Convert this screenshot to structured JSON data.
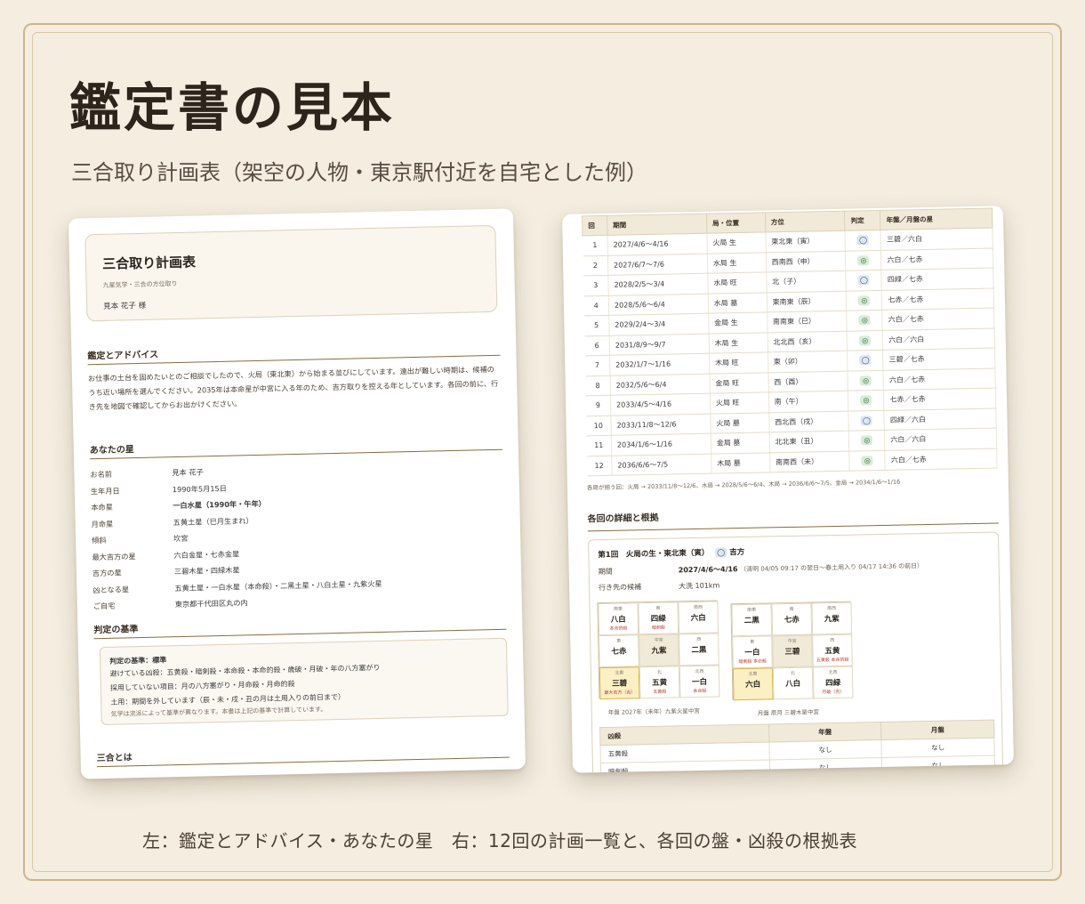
{
  "title": "鑑定書の見本",
  "subtitle": "三合取り計画表（架空の人物・東京駅付近を自宅とした例）",
  "caption": "左：鑑定とアドバイス・あなたの星　右：12回の計画一覧と、各回の盤・凶殺の根拠表",
  "left_page": {
    "header": {
      "title": "三合取り計画表",
      "subtitle": "九星気学・三合の方位取り",
      "name": "見本 花子 様"
    },
    "advice": {
      "heading": "鑑定とアドバイス",
      "text": "お仕事の土台を固めたいとのご相談でしたので、火局（東北東）から始まる並びにしています。遠出が難しい時期は、候補のうち近い場所を選んでください。2035年は本命星が中宮に入る年のため、吉方取りを控える年としています。各回の前に、行き先を地図で確認してからお出かけください。"
    },
    "stars": {
      "heading": "あなたの星",
      "rows": [
        {
          "k": "お名前",
          "v": "見本 花子",
          "bold": false
        },
        {
          "k": "生年月日",
          "v": "1990年5月15日",
          "bold": false
        },
        {
          "k": "本命星",
          "v": "一白水星（1990年・午年）",
          "bold": true
        },
        {
          "k": "月命星",
          "v": "五黄土星（巳月生まれ）",
          "bold": false
        },
        {
          "k": "傾斜",
          "v": "坎宮",
          "bold": false
        },
        {
          "k": "最大吉方の星",
          "v": "六白金星・七赤金星",
          "bold": false
        },
        {
          "k": "吉方の星",
          "v": "三碧木星・四緑木星",
          "bold": false
        },
        {
          "k": "凶となる星",
          "v": "五黄土星・一白水星（本命殺）・二黒土星・八白土星・九紫火星",
          "bold": false
        },
        {
          "k": "ご自宅",
          "v": "東京都千代田区丸の内",
          "bold": false
        }
      ]
    },
    "criteria": {
      "heading": "判定の基準",
      "lines": [
        {
          "text": "判定の基準：標準",
          "style": "t"
        },
        {
          "text": "避けている凶殺：五黄殺・暗剣殺・本命殺・本命的殺・歳破・月破・年の八方塞がり",
          "style": ""
        },
        {
          "text": "採用していない項目：月の八方塞がり・月命殺・月命的殺",
          "style": ""
        },
        {
          "text": "土用：期間を外しています（辰・未・戌・丑の月は土用入りの前日まで）",
          "style": ""
        },
        {
          "text": "気学は流派によって基準が異なります。本書は上記の基準で計算しています。",
          "style": "s"
        }
      ]
    },
    "sango": {
      "heading": "三合とは"
    }
  },
  "right_page": {
    "table_headers": [
      "回",
      "期間",
      "局・位置",
      "方位",
      "判定",
      "年盤／月盤の星"
    ],
    "rows": [
      {
        "n": "1",
        "period": "2027/4/6〜4/16",
        "kyoku": "火局 生",
        "dir": "東北東（寅）",
        "mark": "◯",
        "mk": "o",
        "stars": "三碧／六白"
      },
      {
        "n": "2",
        "period": "2027/6/7〜7/6",
        "kyoku": "水局 生",
        "dir": "西南西（申）",
        "mark": "◎",
        "mk": "d",
        "stars": "六白／七赤"
      },
      {
        "n": "3",
        "period": "2028/2/5〜3/4",
        "kyoku": "水局 旺",
        "dir": "北（子）",
        "mark": "◯",
        "mk": "o",
        "stars": "四緑／七赤"
      },
      {
        "n": "4",
        "period": "2028/5/6〜6/4",
        "kyoku": "水局 墓",
        "dir": "東南東（辰）",
        "mark": "◎",
        "mk": "d",
        "stars": "七赤／七赤"
      },
      {
        "n": "5",
        "period": "2029/2/4〜3/4",
        "kyoku": "金局 生",
        "dir": "南南東（巳）",
        "mark": "◎",
        "mk": "d",
        "stars": "六白／七赤"
      },
      {
        "n": "6",
        "period": "2031/8/9〜9/7",
        "kyoku": "木局 生",
        "dir": "北北西（亥）",
        "mark": "◎",
        "mk": "d",
        "stars": "六白／六白"
      },
      {
        "n": "7",
        "period": "2032/1/7〜1/16",
        "kyoku": "木局 旺",
        "dir": "東（卯）",
        "mark": "◯",
        "mk": "o",
        "stars": "三碧／七赤"
      },
      {
        "n": "8",
        "period": "2032/5/6〜6/4",
        "kyoku": "金局 旺",
        "dir": "西（酉）",
        "mark": "◎",
        "mk": "d",
        "stars": "六白／七赤"
      },
      {
        "n": "9",
        "period": "2033/4/5〜4/16",
        "kyoku": "火局 旺",
        "dir": "南（午）",
        "mark": "◎",
        "mk": "d",
        "stars": "七赤／七赤"
      },
      {
        "n": "10",
        "period": "2033/11/8〜12/6",
        "kyoku": "火局 墓",
        "dir": "西北西（戌）",
        "mark": "◯",
        "mk": "o",
        "stars": "四緑／六白"
      },
      {
        "n": "11",
        "period": "2034/1/6〜1/16",
        "kyoku": "金局 墓",
        "dir": "北北東（丑）",
        "mark": "◎",
        "mk": "d",
        "stars": "六白／六白"
      },
      {
        "n": "12",
        "period": "2036/6/6〜7/5",
        "kyoku": "木局 墓",
        "dir": "南南西（未）",
        "mark": "◎",
        "mk": "d",
        "stars": "六白／七赤"
      }
    ],
    "note": "各局が揃う回：火局 → 2033/11/8〜12/6、水局 → 2028/5/6〜6/4、木局 → 2036/6/6〜7/5、金局 → 2034/1/6〜1/16",
    "detail_heading": "各回の詳細と根拠",
    "detail": {
      "title": "第1回　火局の生・東北東（寅）",
      "mark": "◯",
      "mark_label": "吉方",
      "period_label": "期間",
      "period_value": "2027/4/6〜4/16",
      "period_note": "（清明 04/05 09:17 の翌日〜春土用入り 04/17 14:36 の前日）",
      "dest_label": "行き先の候補",
      "dest_value": "大洗 101km",
      "year_board": [
        {
          "dir": "南東",
          "star": "八白",
          "note": "本命的殺"
        },
        {
          "dir": "南",
          "star": "四緑",
          "note": "暗剣殺"
        },
        {
          "dir": "南西",
          "star": "六白",
          "note": ""
        },
        {
          "dir": "東",
          "star": "七赤",
          "note": ""
        },
        {
          "dir": "中宮",
          "star": "九紫",
          "note": ""
        },
        {
          "dir": "西",
          "star": "二黒",
          "note": ""
        },
        {
          "dir": "北東",
          "star": "三碧",
          "note": "最大吉方（吉）"
        },
        {
          "dir": "北",
          "star": "五黄",
          "note": "五黄殺"
        },
        {
          "dir": "北西",
          "star": "一白",
          "note": "本命殺"
        }
      ],
      "month_board": [
        {
          "dir": "南東",
          "star": "二黒",
          "note": ""
        },
        {
          "dir": "南",
          "star": "七赤",
          "note": ""
        },
        {
          "dir": "南西",
          "star": "九紫",
          "note": ""
        },
        {
          "dir": "東",
          "star": "一白",
          "note": "暗剣殺 本命殺"
        },
        {
          "dir": "中宮",
          "star": "三碧",
          "note": ""
        },
        {
          "dir": "西",
          "star": "五黄",
          "note": "五黄殺 本命的殺"
        },
        {
          "dir": "北東",
          "star": "六白",
          "note": ""
        },
        {
          "dir": "北",
          "star": "八白",
          "note": ""
        },
        {
          "dir": "北西",
          "star": "四緑",
          "note": "月破（吉）"
        }
      ],
      "year_caption": "年盤 2027年（未年）九紫火星中宮",
      "month_caption": "月盤 辰月 三碧木星中宮",
      "kyousatsu_headers": [
        "凶殺",
        "年盤",
        "月盤"
      ],
      "kyousatsu_rows": [
        {
          "name": "五黄殺",
          "year": "なし",
          "month": "なし"
        },
        {
          "name": "暗剣殺",
          "year": "なし",
          "month": "なし"
        }
      ]
    }
  },
  "colors": {
    "background": "#f4ede0",
    "frame": "#cbb68f",
    "rule": "#8a6b3c",
    "mark_good": "#dde6f2",
    "mark_best": "#d9ecd9"
  }
}
